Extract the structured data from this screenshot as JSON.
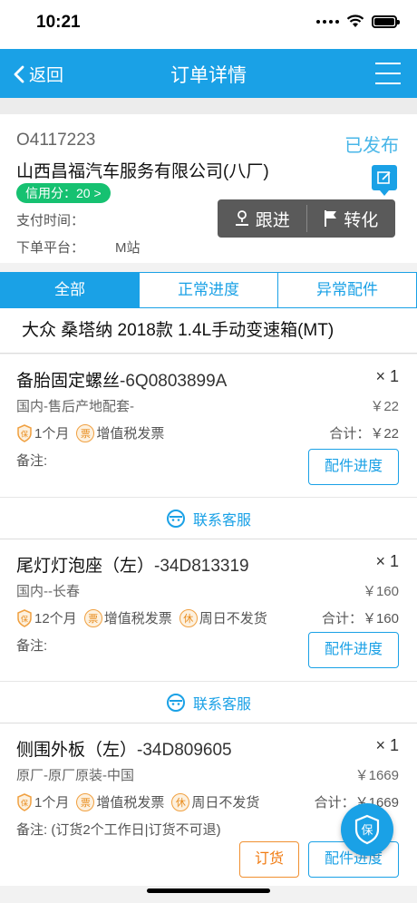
{
  "status_bar": {
    "time": "10:21"
  },
  "nav": {
    "back_label": "返回",
    "title": "订单详情"
  },
  "order": {
    "number": "O4117223",
    "status": "已发布",
    "company": "山西昌福汽车服务有限公司(八厂)",
    "credit": "信用分：20 >",
    "pay_time_label": "支付时间：",
    "platform_label": "下单平台：",
    "platform_value": "M站"
  },
  "actions": {
    "follow": "跟进",
    "convert": "转化"
  },
  "tabs": [
    {
      "label": "全部",
      "active": true
    },
    {
      "label": "正常进度",
      "active": false
    },
    {
      "label": "异常配件",
      "active": false
    }
  ],
  "vehicle": "大众 桑塔纳 2018款 1.4L手动变速箱(MT)",
  "parts": [
    {
      "name": "备胎固定螺丝",
      "code": "-6Q0803899A",
      "qty": "× 1",
      "origin": "国内-售后产地配套-",
      "price": "￥22",
      "warranty": "1个月",
      "invoice": "增值税发票",
      "sunday": "",
      "total": "合计：￥22",
      "remark": "备注:",
      "progress_label": "配件进度",
      "order_label": ""
    },
    {
      "name": "尾灯灯泡座（左）",
      "code": "-34D813319",
      "qty": "× 1",
      "origin": "国内--长春",
      "price": "￥160",
      "warranty": "12个月",
      "invoice": "增值税发票",
      "sunday": "周日不发货",
      "total": "合计：￥160",
      "remark": "备注:",
      "progress_label": "配件进度",
      "order_label": ""
    },
    {
      "name": "侧围外板（左）",
      "code": "-34D809605",
      "qty": "× 1",
      "origin": "原厂-原厂原装-中国",
      "price": "￥1669",
      "warranty": "1个月",
      "invoice": "增值税发票",
      "sunday": "周日不发货",
      "total": "合计：￥1669",
      "remark": "备注:  (订货2个工作日|订货不可退)",
      "progress_label": "配件进度",
      "order_label": "订货"
    }
  ],
  "contact_label": "联系客服",
  "badges": {
    "invoice": "票",
    "rest": "休",
    "shield": "保"
  },
  "colors": {
    "primary": "#1aa1e6",
    "credit_green": "#16c171",
    "orange": "#f07a10"
  }
}
